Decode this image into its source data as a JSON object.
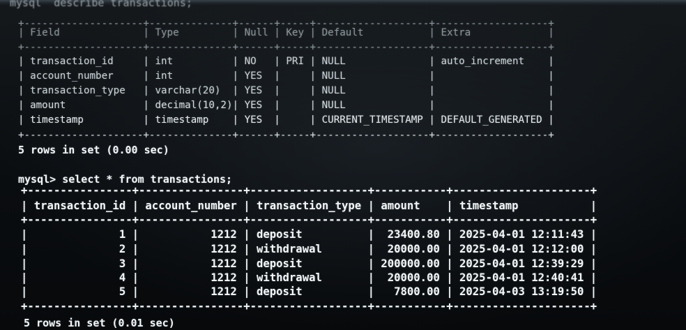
{
  "terminal": {
    "top_command": "mysql  describe transactions;",
    "describe_border_top": "+--------------------+--------------+------+-----+-------------------+-------------------+",
    "describe_header": "| Field              | Type         | Null | Key | Default           | Extra             |",
    "describe_border_mid": "+--------------------+--------------+------+-----+-------------------+-------------------+",
    "describe_rows": [
      "| transaction_id     | int          | NO   | PRI | NULL              | auto_increment    |",
      "| account_number     | int          | YES  |     | NULL              |                   |",
      "| transaction_type   | varchar(20)  | YES  |     | NULL              |                   |",
      "| amount             | decimal(10,2)| YES  |     | NULL              |                   |",
      "| timestamp          | timestamp    | YES  |     | CURRENT_TIMESTAMP | DEFAULT_GENERATED |"
    ],
    "describe_border_bottom": "+--------------------+--------------+------+-----+-------------------+-------------------+",
    "describe_summary": "5 rows in set (0.00 sec)",
    "select_command": "mysql> select * from transactions;",
    "select_border_top": "+----------------+----------------+------------------+-----------+---------------------+",
    "select_header": "| transaction_id | account_number | transaction_type | amount    | timestamp           |",
    "select_border_mid": "+----------------+----------------+------------------+-----------+---------------------+",
    "select_rows": [
      "|              1 |           1212 | deposit          |  23400.80 | 2025-04-01 12:11:43 |",
      "|              2 |           1212 | withdrawal       |  20000.00 | 2025-04-01 12:12:00 |",
      "|              3 |           1212 | deposit          | 200000.00 | 2025-04-01 12:39:29 |",
      "|              4 |           1212 | withdrawal       |  20000.00 | 2025-04-01 12:40:41 |",
      "|              5 |           1212 | deposit          |   7800.00 | 2025-04-03 13:19:50 |"
    ],
    "select_border_bottom": "+----------------+----------------+------------------+-----------+---------------------+",
    "select_summary": "5 rows in set (0.01 sec)"
  }
}
